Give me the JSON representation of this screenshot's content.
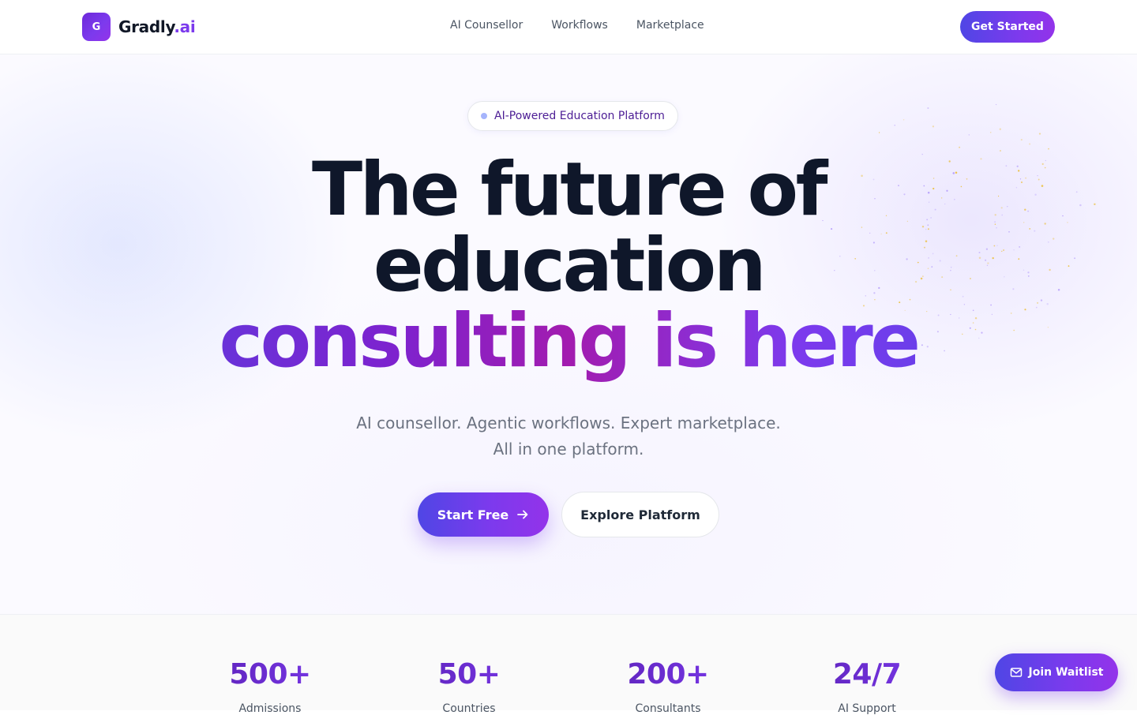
{
  "brand": {
    "logo_letter": "G",
    "name": "Gradly",
    "suffix": ".ai",
    "accent_color": "#7c3aed"
  },
  "nav": {
    "links": [
      "AI Counsellor",
      "Workflows",
      "Marketplace"
    ],
    "cta_label": "Get Started"
  },
  "hero": {
    "badge": "AI-Powered Education Platform",
    "headline_lines": [
      "The future of",
      "education",
      "consulting is here"
    ],
    "subtitle_lines": [
      "AI counsellor. Agentic workflows. Expert marketplace.",
      "All in one platform."
    ],
    "primary_cta": "Start Free",
    "primary_cta_icon": "arrow-right-icon",
    "secondary_cta": "Explore Platform"
  },
  "stats": [
    {
      "value": "500+",
      "label": "Admissions"
    },
    {
      "value": "50+",
      "label": "Countries"
    },
    {
      "value": "200+",
      "label": "Consultants"
    },
    {
      "value": "24/7",
      "label": "AI Support"
    }
  ],
  "floating_cta": {
    "label": "Join Waitlist",
    "icon": "mail-icon"
  }
}
